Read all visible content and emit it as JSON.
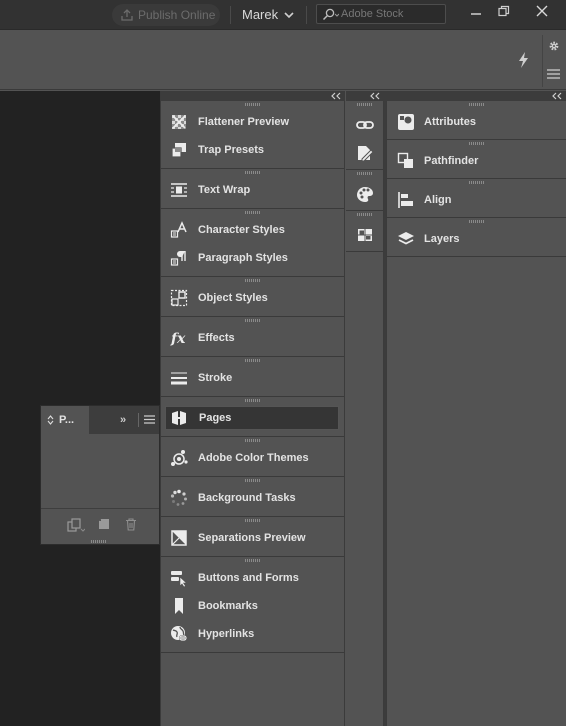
{
  "topbar": {
    "publish_label": "Publish Online",
    "user_name": "Marek",
    "search_placeholder": "Adobe Stock"
  },
  "floating_panel": {
    "tab_label": "P..."
  },
  "column1": {
    "groups": [
      {
        "items": [
          {
            "label": "Flattener Preview",
            "icon": "flattener-icon"
          },
          {
            "label": "Trap Presets",
            "icon": "trap-presets-icon"
          }
        ]
      },
      {
        "items": [
          {
            "label": "Text Wrap",
            "icon": "text-wrap-icon"
          }
        ]
      },
      {
        "items": [
          {
            "label": "Character Styles",
            "icon": "character-styles-icon"
          },
          {
            "label": "Paragraph Styles",
            "icon": "paragraph-styles-icon"
          }
        ]
      },
      {
        "items": [
          {
            "label": "Object Styles",
            "icon": "object-styles-icon"
          }
        ]
      },
      {
        "items": [
          {
            "label": "Effects",
            "icon": "fx-icon"
          }
        ]
      },
      {
        "items": [
          {
            "label": "Stroke",
            "icon": "stroke-icon"
          }
        ]
      },
      {
        "items": [
          {
            "label": "Pages",
            "icon": "pages-icon",
            "active": true
          }
        ]
      },
      {
        "items": [
          {
            "label": "Adobe Color Themes",
            "icon": "color-themes-icon"
          }
        ]
      },
      {
        "items": [
          {
            "label": "Background Tasks",
            "icon": "background-tasks-icon"
          }
        ]
      },
      {
        "items": [
          {
            "label": "Separations Preview",
            "icon": "separations-icon"
          }
        ]
      },
      {
        "items": [
          {
            "label": "Buttons and Forms",
            "icon": "buttons-forms-icon"
          },
          {
            "label": "Bookmarks",
            "icon": "bookmark-icon"
          },
          {
            "label": "Hyperlinks",
            "icon": "hyperlinks-icon"
          }
        ]
      }
    ]
  },
  "column2": {
    "icons": [
      "links-icon",
      "edit-icon",
      "swatches-icon",
      "table-icon"
    ]
  },
  "column3": {
    "groups": [
      {
        "items": [
          {
            "label": "Attributes",
            "icon": "attributes-icon"
          }
        ]
      },
      {
        "items": [
          {
            "label": "Pathfinder",
            "icon": "pathfinder-icon"
          }
        ]
      },
      {
        "items": [
          {
            "label": "Align",
            "icon": "align-icon"
          }
        ]
      },
      {
        "items": [
          {
            "label": "Layers",
            "icon": "layers-icon"
          }
        ]
      }
    ]
  },
  "colors": {
    "panel_bg": "#535353",
    "chrome_bg": "#323232",
    "pasteboard": "#222222",
    "text": "#e3e3e3"
  }
}
